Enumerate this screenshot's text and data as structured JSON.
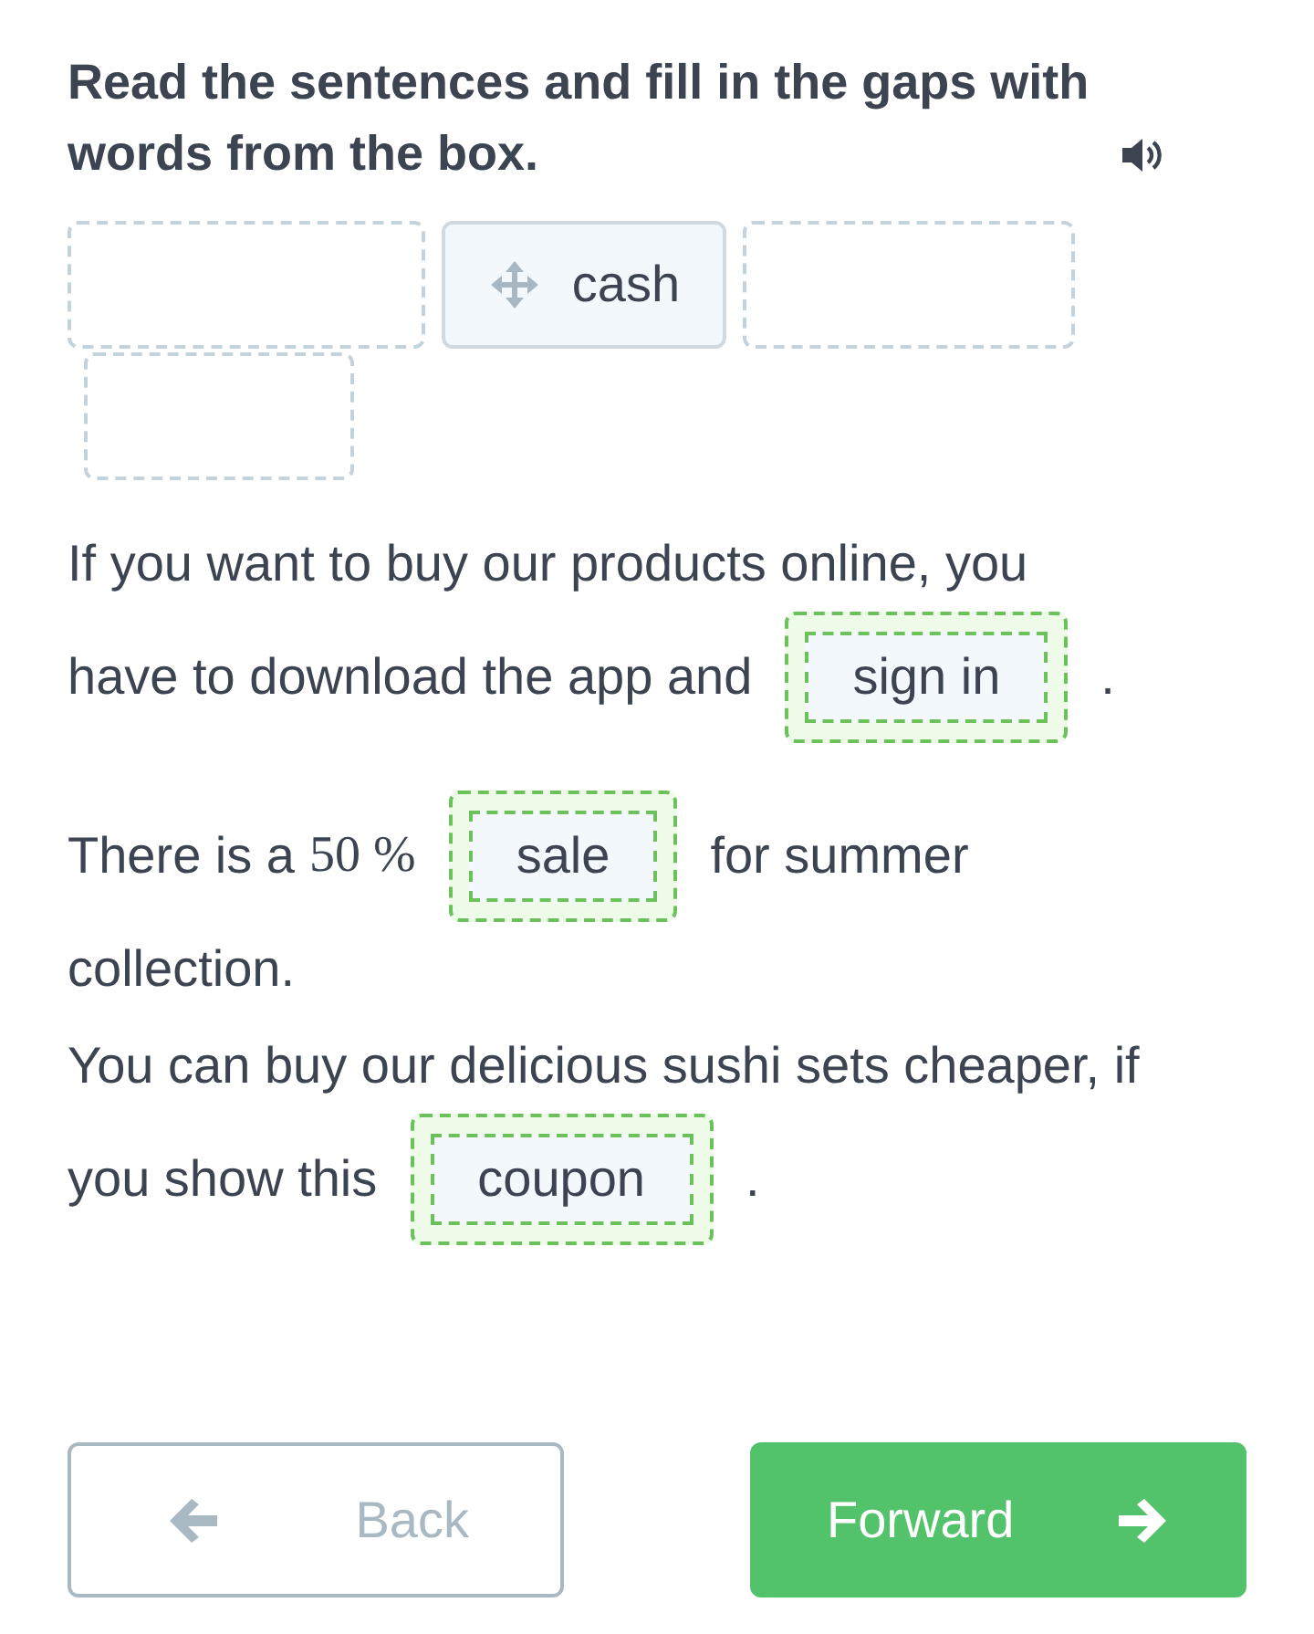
{
  "instruction": {
    "text": "Read the sentences and fill in the gaps with words from the box."
  },
  "word_bank": [
    {
      "kind": "empty"
    },
    {
      "kind": "word",
      "text": "cash"
    },
    {
      "kind": "empty"
    },
    {
      "kind": "empty"
    }
  ],
  "sentences": [
    {
      "lines": [
        [
          {
            "kind": "text",
            "text": "If you want to buy our products online, you"
          }
        ],
        [
          {
            "kind": "text",
            "text": "have to download the app and"
          },
          {
            "kind": "gap",
            "text": "sign in",
            "correct": true
          },
          {
            "kind": "text",
            "text": "."
          }
        ]
      ]
    },
    {
      "lines": [
        [
          {
            "kind": "text",
            "text": "There is a"
          },
          {
            "kind": "formula",
            "text": "50 %"
          },
          {
            "kind": "gap",
            "text": "sale",
            "correct": true
          },
          {
            "kind": "text",
            "text": "for summer"
          }
        ],
        [
          {
            "kind": "text",
            "text": "collection."
          }
        ]
      ]
    },
    {
      "lines": [
        [
          {
            "kind": "text",
            "text": "You can buy our delicious sushi sets cheaper, if"
          }
        ],
        [
          {
            "kind": "text",
            "text": "you show this"
          },
          {
            "kind": "gap",
            "text": "coupon",
            "correct": true
          },
          {
            "kind": "text",
            "text": "."
          }
        ]
      ]
    }
  ],
  "buttons": [
    {
      "kind": "back",
      "label": "Back",
      "disabled": true
    },
    {
      "kind": "forward",
      "label": "Forward",
      "disabled": false
    }
  ]
}
